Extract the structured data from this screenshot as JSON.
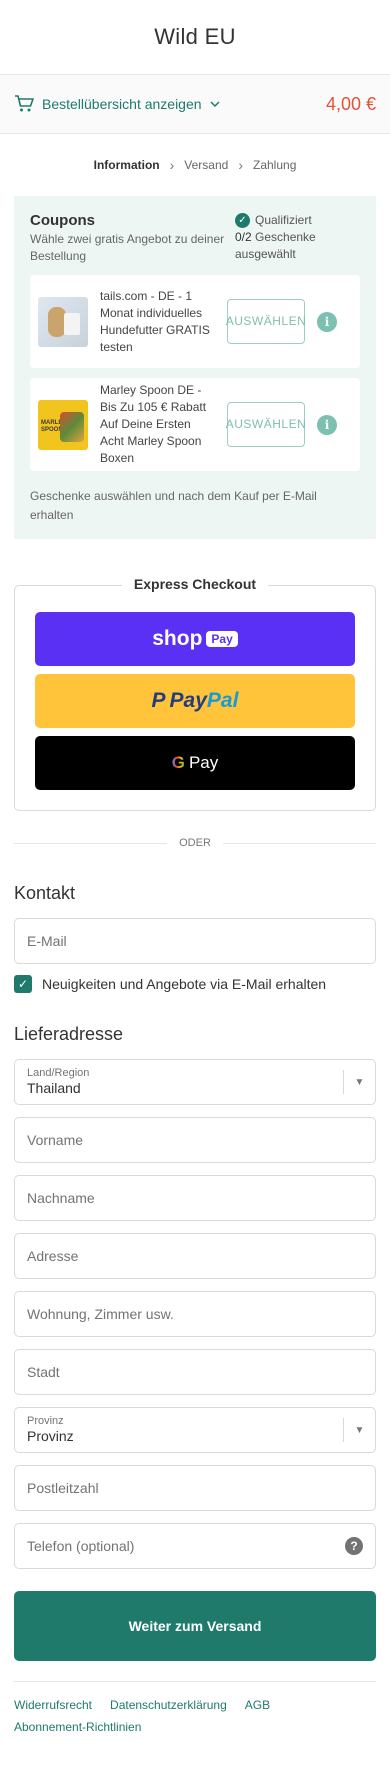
{
  "store": {
    "title": "Wild EU"
  },
  "summary": {
    "toggle_label": "Bestellübersicht anzeigen",
    "total": "4,00 €"
  },
  "breadcrumb": {
    "information": "Information",
    "shipping": "Versand",
    "payment": "Zahlung"
  },
  "coupons": {
    "title": "Coupons",
    "subtitle": "Wähle zwei gratis Angebot zu deiner Bestellung",
    "qualified_label": "Qualifiziert",
    "count": "0/2",
    "count_suffix": "Geschenke ausgewählt",
    "offers": [
      {
        "text": "tails.com - DE - 1 Monat individuelles Hundefutter GRATIS testen",
        "button": "AUSWÄHLEN"
      },
      {
        "text": "Marley Spoon DE - Bis Zu 105 € Rabatt Auf Deine Ersten Acht Marley Spoon Boxen",
        "button": "AUSWÄHLEN",
        "logo": "MARLEY SPOON"
      }
    ],
    "note": "Geschenke auswählen und nach dem Kauf per E-Mail erhalten"
  },
  "express": {
    "title": "Express Checkout",
    "shop_pay": {
      "shop": "shop",
      "pay": "Pay"
    },
    "paypal": {
      "pay": "Pay",
      "pal": "Pal",
      "mark": "P"
    },
    "gpay": {
      "g": "G",
      "pay": "Pay"
    }
  },
  "divider": "ODER",
  "contact": {
    "title": "Kontakt",
    "email_placeholder": "E-Mail",
    "newsletter_label": "Neuigkeiten und Angebote via E-Mail erhalten"
  },
  "shipping": {
    "title": "Lieferadresse",
    "country_label": "Land/Region",
    "country_value": "Thailand",
    "first_name": "Vorname",
    "last_name": "Nachname",
    "address": "Adresse",
    "apartment": "Wohnung, Zimmer usw.",
    "city": "Stadt",
    "province_label": "Provinz",
    "province_value": "Provinz",
    "postal": "Postleitzahl",
    "phone": "Telefon (optional)"
  },
  "continue_label": "Weiter zum Versand",
  "footer": [
    "Widerrufsrecht",
    "Datenschutzerklärung",
    "AGB",
    "Abonnement-Richtlinien"
  ],
  "colors": {
    "accent": "#1f7a6c",
    "total": "#e0533a",
    "shop_pay": "#5a31f4",
    "paypal": "#ffc439"
  },
  "icons": {
    "cart": "cart-icon",
    "chevron": "chevron-down-icon",
    "check": "check-icon",
    "info": "info-icon",
    "help": "help-icon"
  }
}
